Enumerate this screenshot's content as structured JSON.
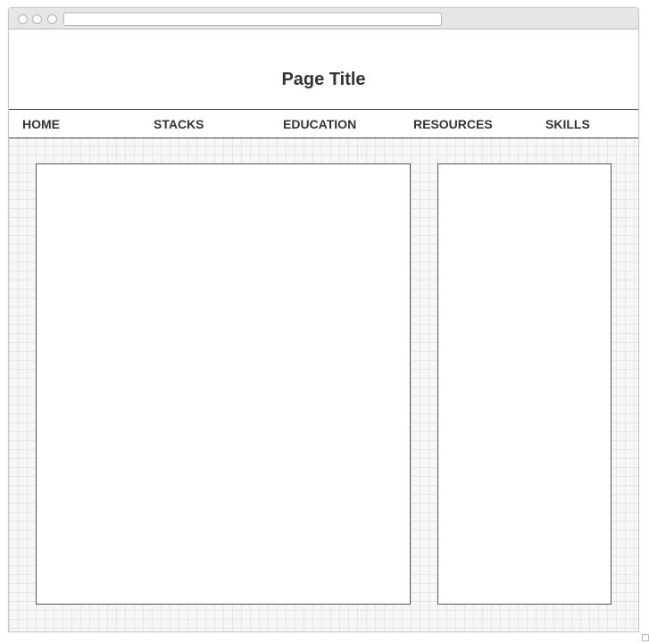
{
  "page": {
    "title": "Page Title"
  },
  "nav": {
    "items": [
      {
        "label": "HOME"
      },
      {
        "label": "STACKS"
      },
      {
        "label": "EDUCATION"
      },
      {
        "label": "RESOURCES"
      },
      {
        "label": "SKILLS"
      }
    ]
  },
  "browser": {
    "url": ""
  },
  "colors": {
    "text": "#333333",
    "border": "#444444",
    "grid": "#e6e6e6",
    "background": "#f7f7f7"
  }
}
